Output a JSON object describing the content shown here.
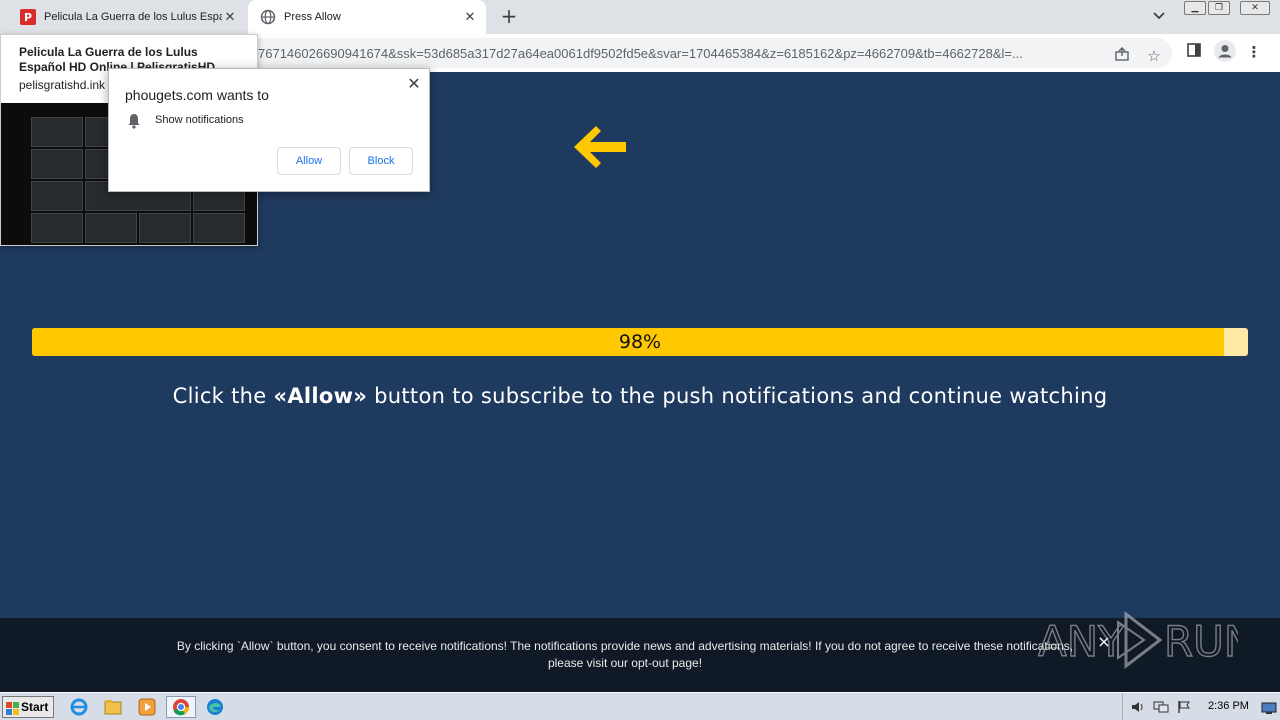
{
  "browser": {
    "tabs": [
      {
        "title": "Pelicula La Guerra de los Lulus Español HD Online | PelisgratisHD",
        "favicon": "pelisgratis-icon",
        "active": false
      },
      {
        "title": "Press Allow",
        "favicon": "globe-icon",
        "active": true
      }
    ],
    "new_tab_label": "+",
    "url": "767146026690941674&ssk=53d685a317d27a64ea0061df9502fd5e&svar=1704465384&z=6185162&pz=4662709&tb=4662728&l=...",
    "window_controls": [
      "minimize",
      "restore",
      "close"
    ]
  },
  "hover_card": {
    "title": "Pelicula La Guerra de los Lulus Español HD Online | PelisgratisHD",
    "domain": "pelisgratishd.ink"
  },
  "permission_prompt": {
    "title": "phougets.com wants to",
    "permission": "Show notifications",
    "allow_label": "Allow",
    "block_label": "Block"
  },
  "page": {
    "progress_percent": 98,
    "progress_label": "98%",
    "headline_prefix": "Click the ",
    "headline_emphasis": "«Allow»",
    "headline_suffix": " button to subscribe to the push notifications and continue watching",
    "accent_color": "#ffc800",
    "background_color": "#1f3a5f"
  },
  "consent_bar": {
    "text": "By clicking `Allow` button, you consent to receive notifications! The notifications provide news and advertising materials! If you do not agree to receive these notifications, please visit our opt-out page!",
    "close_label": "×"
  },
  "watermark": {
    "text": "ANY RUN"
  },
  "taskbar": {
    "start_label": "Start",
    "apps": [
      "ie-icon",
      "explorer-icon",
      "media-player-icon",
      "chrome-icon",
      "edge-icon"
    ],
    "clock": "2:36 PM"
  }
}
